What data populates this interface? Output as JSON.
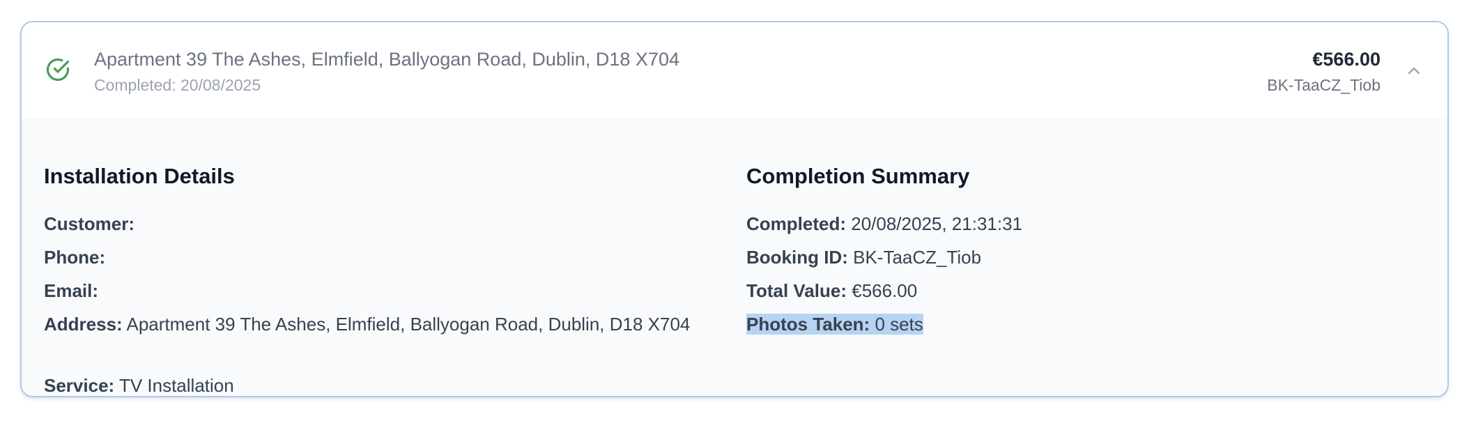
{
  "header": {
    "address": "Apartment 39 The Ashes, Elmfield, Ballyogan Road, Dublin, D18 X704",
    "completed_label": "Completed: 20/08/2025",
    "price": "€566.00",
    "booking_id": "BK-TaaCZ_Tiob",
    "status_icon": "check-circle-icon",
    "status_color": "#4a9e4f",
    "toggle_icon": "chevron-up-icon"
  },
  "installation": {
    "title": "Installation Details",
    "customer_label": "Customer:",
    "customer_value": "",
    "phone_label": "Phone:",
    "phone_value": "",
    "email_label": "Email:",
    "email_value": "",
    "address_label": "Address:",
    "address_value": "Apartment 39 The Ashes, Elmfield, Ballyogan Road, Dublin, D18 X704",
    "service_label": "Service:",
    "service_value": "TV Installation"
  },
  "summary": {
    "title": "Completion Summary",
    "completed_label": "Completed:",
    "completed_value": "20/08/2025, 21:31:31",
    "booking_label": "Booking ID:",
    "booking_value": "BK-TaaCZ_Tiob",
    "total_label": "Total Value:",
    "total_value": "€566.00",
    "photos_label": "Photos Taken:",
    "photos_value": "0 sets"
  },
  "colors": {
    "card_border": "#a9c9f0",
    "body_background": "#f8fafc",
    "selection_highlight": "#b6d3f2"
  }
}
